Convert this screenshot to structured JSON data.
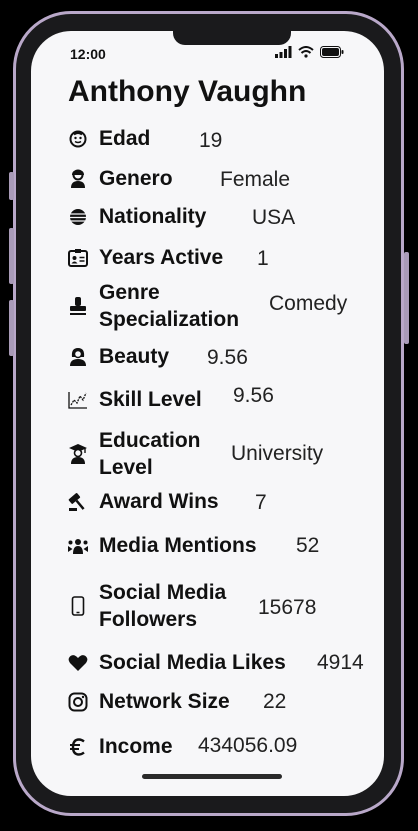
{
  "status": {
    "time": "12:00"
  },
  "profile": {
    "name": "Anthony Vaughn",
    "fields": [
      {
        "label": "Edad",
        "value": "19",
        "icon": "face-icon"
      },
      {
        "label": "Genero",
        "value": "Female",
        "icon": "person-icon"
      },
      {
        "label": "Nationality",
        "value": "USA",
        "icon": "globe-icon"
      },
      {
        "label": "Years Active",
        "value": "1",
        "icon": "id-card-icon"
      },
      {
        "label_line1": "Genre",
        "label_line2": "Specialization",
        "value": "Comedy",
        "icon": "stamp-icon"
      },
      {
        "label": "Beauty",
        "value": "9.56",
        "icon": "woman-icon"
      },
      {
        "label": "Skill Level",
        "value": "9.56",
        "icon": "line-chart-icon"
      },
      {
        "label_line1": "Education",
        "label_line2": "Level",
        "value": "University",
        "icon": "graduate-icon"
      },
      {
        "label": "Award Wins",
        "value": "7",
        "icon": "gavel-icon"
      },
      {
        "label": "Media Mentions",
        "value": "52",
        "icon": "people-icon"
      },
      {
        "label_line1": "Social Media",
        "label_line2": "Followers",
        "value": "15678",
        "icon": "phone-icon"
      },
      {
        "label": "Social Media Likes",
        "value": "4914",
        "icon": "heart-icon"
      },
      {
        "label": "Network Size",
        "value": "22",
        "icon": "instagram-icon"
      },
      {
        "label": "Income",
        "value": "434056.09",
        "icon": "euro-icon"
      }
    ]
  }
}
